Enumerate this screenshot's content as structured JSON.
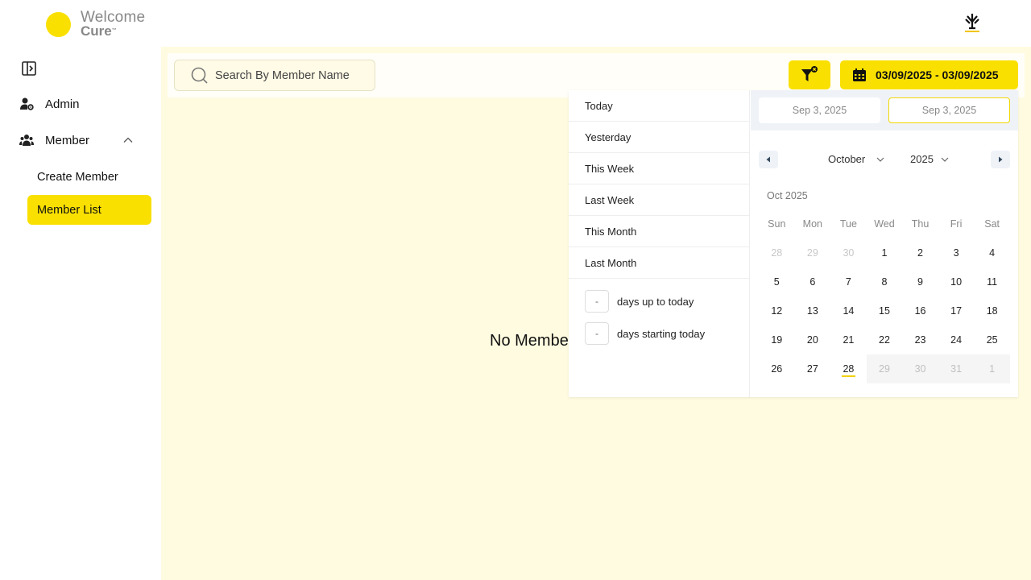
{
  "brand": {
    "line1": "Welcome",
    "line2": "Cure",
    "tm": "™",
    "accent_color": "#f9e000"
  },
  "sidebar": {
    "items": [
      {
        "label": "Admin",
        "icon": "user-gear-icon"
      },
      {
        "label": "Member",
        "icon": "users-icon",
        "expanded": true
      }
    ],
    "sub_items": [
      {
        "label": "Create Member"
      },
      {
        "label": "Member List",
        "active": true
      }
    ]
  },
  "toolbar": {
    "search_placeholder": "Search By Member Name",
    "date_range_label": "03/09/2025 - 03/09/2025"
  },
  "main": {
    "empty_message": "No Members Found"
  },
  "picker": {
    "ranges": [
      "Today",
      "Yesterday",
      "This Week",
      "Last Week",
      "This Month",
      "Last Month"
    ],
    "range_inputs": [
      {
        "value": "-",
        "label": "days up to today"
      },
      {
        "value": "-",
        "label": "days starting today"
      }
    ],
    "start_date": "Sep 3, 2025",
    "end_date": "Sep 3, 2025",
    "month": "October",
    "year": "2025",
    "month_label": "Oct 2025",
    "weekdays": [
      "Sun",
      "Mon",
      "Tue",
      "Wed",
      "Thu",
      "Fri",
      "Sat"
    ],
    "weeks": [
      [
        {
          "d": "28",
          "s": "passive"
        },
        {
          "d": "29",
          "s": "passive"
        },
        {
          "d": "30",
          "s": "passive"
        },
        {
          "d": "1"
        },
        {
          "d": "2"
        },
        {
          "d": "3"
        },
        {
          "d": "4"
        }
      ],
      [
        {
          "d": "5"
        },
        {
          "d": "6"
        },
        {
          "d": "7"
        },
        {
          "d": "8"
        },
        {
          "d": "9"
        },
        {
          "d": "10"
        },
        {
          "d": "11"
        }
      ],
      [
        {
          "d": "12"
        },
        {
          "d": "13"
        },
        {
          "d": "14"
        },
        {
          "d": "15"
        },
        {
          "d": "16"
        },
        {
          "d": "17"
        },
        {
          "d": "18"
        }
      ],
      [
        {
          "d": "19"
        },
        {
          "d": "20"
        },
        {
          "d": "21"
        },
        {
          "d": "22"
        },
        {
          "d": "23"
        },
        {
          "d": "24"
        },
        {
          "d": "25"
        }
      ],
      [
        {
          "d": "26"
        },
        {
          "d": "27"
        },
        {
          "d": "28",
          "s": "today"
        },
        {
          "d": "29",
          "s": "disabled"
        },
        {
          "d": "30",
          "s": "disabled"
        },
        {
          "d": "31",
          "s": "disabled"
        },
        {
          "d": "1",
          "s": "disabled"
        }
      ]
    ]
  }
}
